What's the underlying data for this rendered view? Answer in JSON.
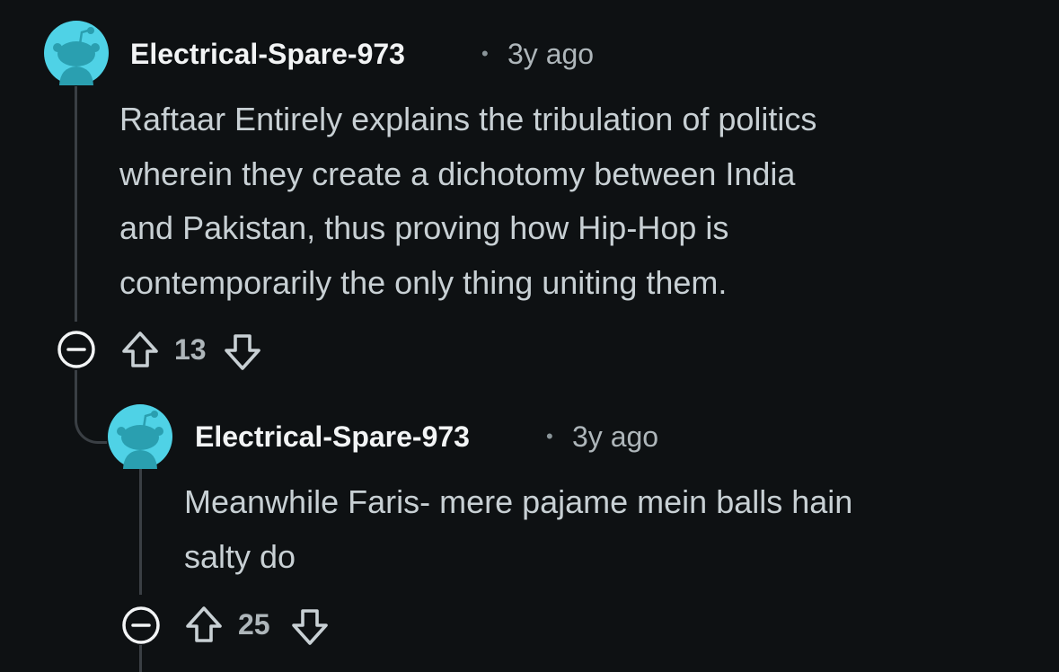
{
  "colors": {
    "background": "#0e1113",
    "avatar": "#4fd2e6",
    "text": "#c8d0d4",
    "author": "#f2f4f5",
    "meta": "#aeb6ba",
    "line": "#3a3f44"
  },
  "comments": [
    {
      "author": "Electrical-Spare-973",
      "separator": "•",
      "time": "3y ago",
      "body": "Raftaar Entirely explains the tribulation of politics\nwherein they create a dichotomy between India\nand Pakistan, thus proving how Hip-Hop is\ncontemporarily the only thing uniting them.",
      "votes": "13",
      "icons": {
        "avatar": "snoo-avatar-icon",
        "collapse": "collapse-minus-icon",
        "upvote": "upvote-arrow-icon",
        "downvote": "downvote-arrow-icon"
      }
    },
    {
      "author": "Electrical-Spare-973",
      "separator": "•",
      "time": "3y ago",
      "body": "Meanwhile Faris- mere pajame mein balls hain\nsalty do",
      "votes": "25",
      "icons": {
        "avatar": "snoo-avatar-icon",
        "collapse": "collapse-minus-icon",
        "upvote": "upvote-arrow-icon",
        "downvote": "downvote-arrow-icon"
      }
    }
  ]
}
